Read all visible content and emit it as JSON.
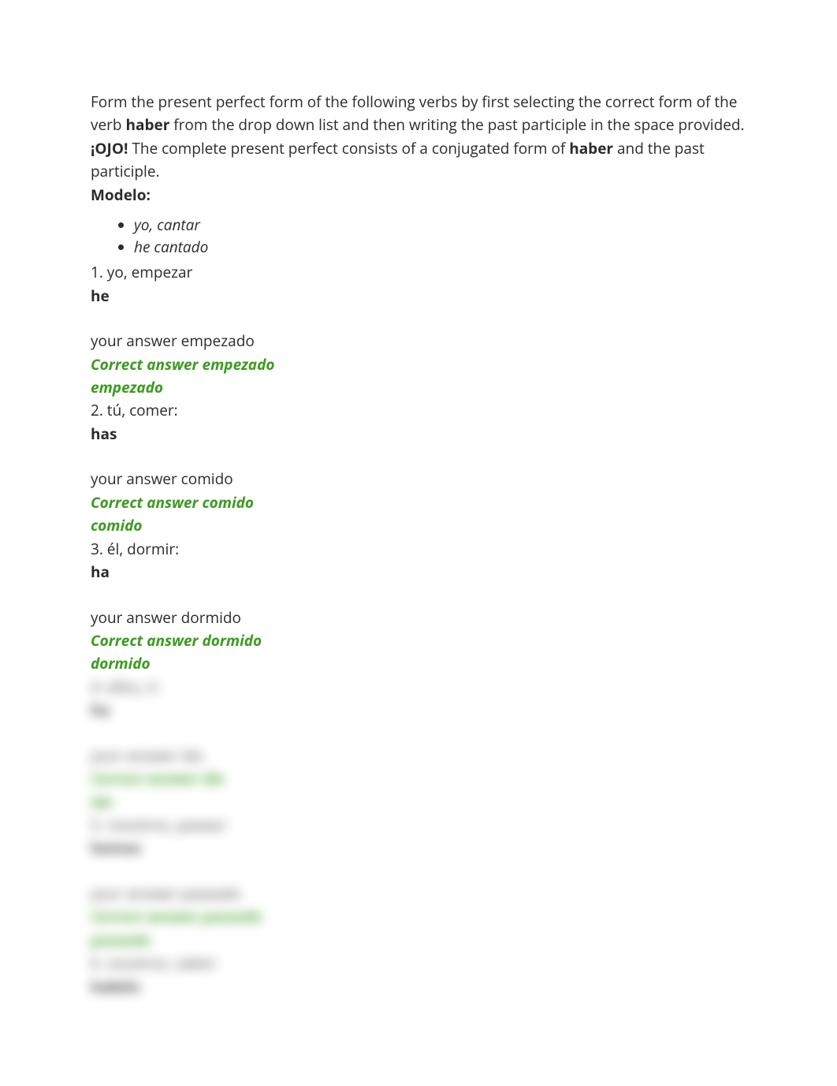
{
  "instructions": {
    "part1": "Form the present perfect form of the following verbs by first selecting the correct form of the verb ",
    "verb1": "haber",
    "part2": " from the drop down list and then writing the past participle in the space provided. ",
    "ojo": "¡OJO!",
    "part3": " The complete present perfect consists of a conjugated form of ",
    "verb2": "haber",
    "part4": " and the past participle."
  },
  "modelo_label": "Modelo:",
  "modelo": {
    "prompt": "yo, cantar",
    "answer": "he cantado"
  },
  "exercises": [
    {
      "num": "1. ",
      "prompt": "yo, empezar",
      "haber": "he",
      "your_answer_label": "your answer ",
      "your_answer": "empezado",
      "correct_label": "Correct answer ",
      "correct_answer": "empezado",
      "repeat": "empezado"
    },
    {
      "num": "2. ",
      "prompt": "tú, comer:",
      "haber": "has",
      "your_answer_label": "your answer ",
      "your_answer": "comido",
      "correct_label": "Correct answer ",
      "correct_answer": "comido",
      "repeat": "comido"
    },
    {
      "num": "3. ",
      "prompt": "él, dormir:",
      "haber": "ha",
      "your_answer_label": "your answer ",
      "your_answer": "dormido",
      "correct_label": "Correct answer ",
      "correct_answer": "dormido",
      "repeat": "dormido"
    }
  ],
  "blurred": [
    {
      "num": "4. ",
      "prompt": "ellos, ir:",
      "haber": "ha",
      "your_answer_label": "your answer ",
      "your_answer": "ido",
      "correct_label": "Correct answer ",
      "correct_answer": "ido",
      "repeat": "ido"
    },
    {
      "num": "5. ",
      "prompt": "nosotros, pasear:",
      "haber": "hemos",
      "your_answer_label": "your answer ",
      "your_answer": "paseado",
      "correct_label": "Correct answer ",
      "correct_answer": "paseado",
      "repeat": "paseado"
    },
    {
      "num": "6. ",
      "prompt": "vosotros, saber:",
      "haber": "habéis"
    }
  ]
}
